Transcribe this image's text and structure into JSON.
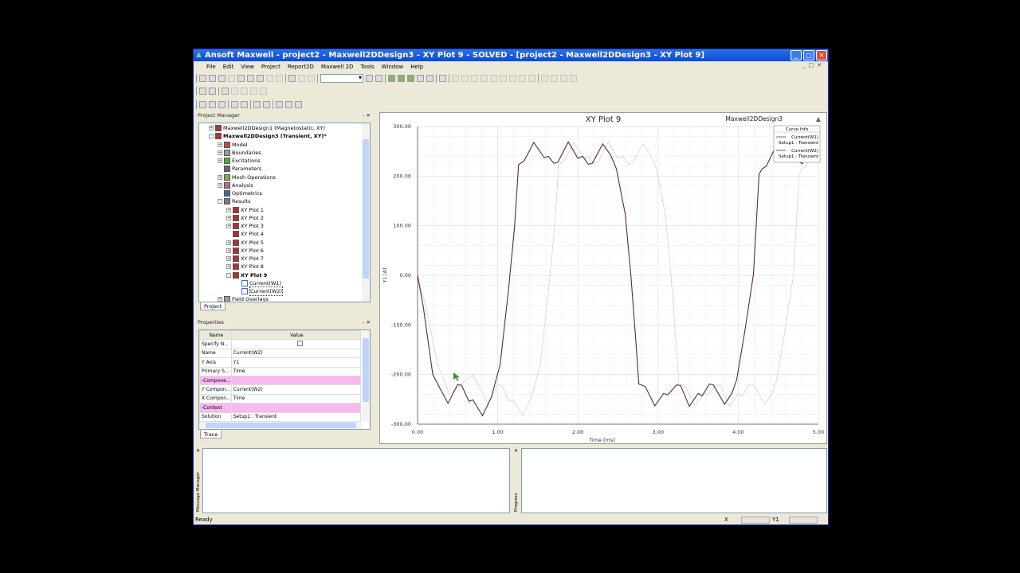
{
  "window": {
    "title": "Ansoft Maxwell  - project2 - Maxwell2DDesign3 - XY Plot 9 - SOLVED - [project2 - Maxwell2DDesign3 - XY Plot 9]"
  },
  "menu": [
    "File",
    "Edit",
    "View",
    "Project",
    "Report2D",
    "Maxwell 2D",
    "Tools",
    "Window",
    "Help"
  ],
  "project_manager": {
    "title": "Project Manager",
    "tab": "Project",
    "items": [
      {
        "label": "Maxwell2DDesign1 (Magnetostatic, XY)",
        "level": 0,
        "exp": "+",
        "bold": false
      },
      {
        "label": "Maxwell2DDesign3 (Transient, XY)*",
        "level": 0,
        "exp": "-",
        "bold": true
      },
      {
        "label": "Model",
        "level": 1,
        "exp": "+"
      },
      {
        "label": "Boundaries",
        "level": 1,
        "exp": "+"
      },
      {
        "label": "Excitations",
        "level": 1,
        "exp": "+"
      },
      {
        "label": "Parameters",
        "level": 1,
        "exp": ""
      },
      {
        "label": "Mesh Operations",
        "level": 1,
        "exp": "+"
      },
      {
        "label": "Analysis",
        "level": 1,
        "exp": "+"
      },
      {
        "label": "Optimetrics",
        "level": 1,
        "exp": ""
      },
      {
        "label": "Results",
        "level": 1,
        "exp": "-"
      },
      {
        "label": "XY Plot 1",
        "level": 2,
        "exp": "+"
      },
      {
        "label": "XY Plot 2",
        "level": 2,
        "exp": "+"
      },
      {
        "label": "XY Plot 3",
        "level": 2,
        "exp": "+"
      },
      {
        "label": "XY Plot 4",
        "level": 2,
        "exp": ""
      },
      {
        "label": "XY Plot 5",
        "level": 2,
        "exp": "+"
      },
      {
        "label": "XY Plot 6",
        "level": 2,
        "exp": "+"
      },
      {
        "label": "XY Plot 7",
        "level": 2,
        "exp": "+"
      },
      {
        "label": "XY Plot 8",
        "level": 2,
        "exp": "+"
      },
      {
        "label": "XY Plot 9",
        "level": 2,
        "exp": "-",
        "bold": true
      },
      {
        "label": "Current(W1)",
        "level": 3,
        "exp": ""
      },
      {
        "label": "Current(W2)",
        "level": 3,
        "exp": "",
        "selected": true
      },
      {
        "label": "Field Overlays",
        "level": 1,
        "exp": "+"
      }
    ]
  },
  "properties": {
    "title": "Properties",
    "tab": "Trace",
    "headers": [
      "Name",
      "Value"
    ],
    "rows": [
      {
        "name": "Specify N...",
        "value": "",
        "checkbox": true
      },
      {
        "name": "Name",
        "value": "Current(W2)"
      },
      {
        "name": "Y Axis",
        "value": "Y1"
      },
      {
        "name": "Primary S...",
        "value": "Time"
      },
      {
        "name": "-Compone...",
        "value": "",
        "section": true
      },
      {
        "name": "Y Compon...",
        "value": "Current(W2)"
      },
      {
        "name": "X Compon...",
        "value": "Time"
      },
      {
        "name": "-Context",
        "value": "",
        "section": true
      },
      {
        "name": "Solution",
        "value": "Setup1 : Transient"
      }
    ]
  },
  "bottom": {
    "message_manager": "Message Manager",
    "progress": "Progress"
  },
  "status": {
    "text": "Ready",
    "x_label": "X",
    "y_label": "Y1"
  },
  "colors": {
    "w1": "#5a2a3a",
    "w2": "#d8d8d8",
    "grid": "#e6e6e6",
    "section": "#f9b8f0"
  },
  "chart_data": {
    "type": "line",
    "title": "XY Plot 9",
    "design_label": "Maxwell2DDesign3",
    "xlabel": "Time [ms]",
    "ylabel": "Y1 [A]",
    "xlim": [
      0,
      5
    ],
    "ylim": [
      -300,
      300
    ],
    "xticks": [
      "0.00",
      "1.00",
      "2.00",
      "3.00",
      "4.00",
      "5.00"
    ],
    "yticks": [
      "300.00",
      "200.00",
      "100.00",
      "0.00",
      "-100.00",
      "-200.00",
      "-300.00"
    ],
    "grid": true,
    "legend": {
      "title": "Curve Info",
      "placement": "top-right",
      "entries": [
        {
          "name": "Current(W1)",
          "sub": "Setup1 : Transient"
        },
        {
          "name": "Current(W2)",
          "sub": "Setup1 : Transient"
        }
      ]
    },
    "series": [
      {
        "name": "Current(W1)",
        "points": [
          [
            0,
            0
          ],
          [
            0.07,
            -62
          ],
          [
            0.19,
            -200
          ],
          [
            0.26,
            -222
          ],
          [
            0.38,
            -258
          ],
          [
            0.5,
            -220
          ],
          [
            0.55,
            -222
          ],
          [
            0.64,
            -254
          ],
          [
            0.69,
            -251
          ],
          [
            0.81,
            -283
          ],
          [
            0.92,
            -246
          ],
          [
            1.03,
            -180
          ],
          [
            1.13,
            -36
          ],
          [
            1.21,
            98
          ],
          [
            1.26,
            223
          ],
          [
            1.33,
            231
          ],
          [
            1.45,
            268
          ],
          [
            1.58,
            237
          ],
          [
            1.63,
            240
          ],
          [
            1.7,
            226
          ],
          [
            1.75,
            228
          ],
          [
            1.88,
            269
          ],
          [
            2.0,
            236
          ],
          [
            2.06,
            240
          ],
          [
            2.13,
            224
          ],
          [
            2.18,
            226
          ],
          [
            2.31,
            265
          ],
          [
            2.41,
            242
          ],
          [
            2.48,
            215
          ],
          [
            2.59,
            124
          ],
          [
            2.66,
            2
          ],
          [
            2.72,
            -126
          ],
          [
            2.76,
            -219
          ],
          [
            2.84,
            -224
          ],
          [
            2.96,
            -263
          ],
          [
            3.07,
            -238
          ],
          [
            3.12,
            -241
          ],
          [
            3.23,
            -221
          ],
          [
            3.28,
            -222
          ],
          [
            3.39,
            -264
          ],
          [
            3.5,
            -238
          ],
          [
            3.55,
            -243
          ],
          [
            3.64,
            -219
          ],
          [
            3.69,
            -221
          ],
          [
            3.83,
            -260
          ],
          [
            3.92,
            -238
          ],
          [
            3.98,
            -211
          ],
          [
            4.08,
            -115
          ],
          [
            4.19,
            2
          ],
          [
            4.26,
            204
          ],
          [
            4.3,
            215
          ],
          [
            4.35,
            220
          ],
          [
            4.46,
            257
          ],
          [
            4.6,
            266
          ],
          [
            4.72,
            232
          ],
          [
            4.8,
            225
          ],
          [
            4.92,
            262
          ],
          [
            5.0,
            250
          ]
        ]
      },
      {
        "name": "Current(W2)",
        "points": [
          [
            0,
            0
          ],
          [
            0.1,
            -60
          ],
          [
            0.25,
            -180
          ],
          [
            0.4,
            -240
          ],
          [
            0.69,
            -200
          ],
          [
            0.76,
            -222
          ],
          [
            0.88,
            -258
          ],
          [
            1.0,
            -220
          ],
          [
            1.05,
            -222
          ],
          [
            1.14,
            -254
          ],
          [
            1.19,
            -251
          ],
          [
            1.31,
            -283
          ],
          [
            1.42,
            -246
          ],
          [
            1.53,
            -180
          ],
          [
            1.63,
            -36
          ],
          [
            1.71,
            98
          ],
          [
            1.76,
            223
          ],
          [
            1.83,
            231
          ],
          [
            1.95,
            268
          ],
          [
            2.08,
            237
          ],
          [
            2.13,
            240
          ],
          [
            2.2,
            226
          ],
          [
            2.25,
            228
          ],
          [
            2.38,
            269
          ],
          [
            2.5,
            236
          ],
          [
            2.56,
            240
          ],
          [
            2.63,
            224
          ],
          [
            2.68,
            226
          ],
          [
            2.81,
            265
          ],
          [
            2.91,
            242
          ],
          [
            2.98,
            215
          ],
          [
            3.09,
            124
          ],
          [
            3.16,
            2
          ],
          [
            3.22,
            -126
          ],
          [
            3.26,
            -219
          ],
          [
            3.34,
            -224
          ],
          [
            3.46,
            -263
          ],
          [
            3.57,
            -238
          ],
          [
            3.62,
            -241
          ],
          [
            3.73,
            -221
          ],
          [
            3.78,
            -222
          ],
          [
            3.89,
            -264
          ],
          [
            4.0,
            -238
          ],
          [
            4.05,
            -243
          ],
          [
            4.14,
            -219
          ],
          [
            4.19,
            -221
          ],
          [
            4.33,
            -260
          ],
          [
            4.42,
            -238
          ],
          [
            4.48,
            -211
          ],
          [
            4.58,
            -115
          ],
          [
            4.69,
            2
          ],
          [
            4.76,
            204
          ],
          [
            4.8,
            215
          ],
          [
            4.85,
            220
          ],
          [
            4.96,
            257
          ],
          [
            5.0,
            262
          ]
        ]
      }
    ]
  }
}
